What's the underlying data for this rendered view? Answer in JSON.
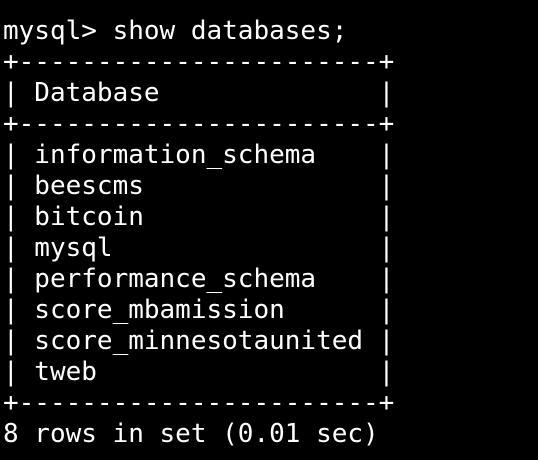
{
  "terminal": {
    "prompt_line": "mysql> show databases;",
    "border_top": "+-----------------------+",
    "header_row": "| Database              |",
    "border_mid": "+-----------------------+",
    "rows": [
      "| information_schema    |",
      "| beescms               |",
      "| bitcoin               |",
      "| mysql                 |",
      "| performance_schema    |",
      "| score_mbamission      |",
      "| score_minnesotaunited |",
      "| tweb                  |"
    ],
    "border_bottom": "+-----------------------+",
    "result_line": "8 rows in set (0.01 sec)"
  }
}
